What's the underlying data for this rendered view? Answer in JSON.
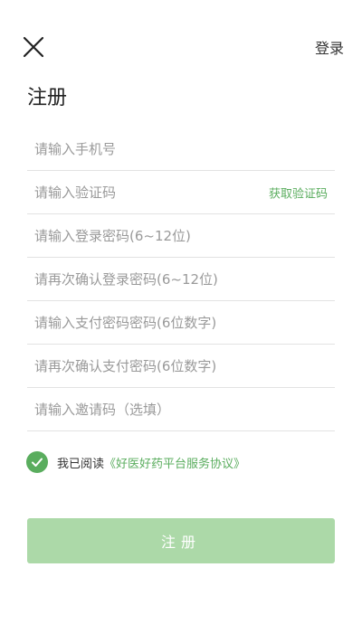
{
  "header": {
    "close_icon": "close-icon",
    "login_label": "登录"
  },
  "page": {
    "title": "注册"
  },
  "form": {
    "phone_placeholder": "请输入手机号",
    "code_placeholder": "请输入验证码",
    "get_code_label": "获取验证码",
    "password_placeholder": "请输入登录密码(6~12位)",
    "password_confirm_placeholder": "请再次确认登录密码(6~12位)",
    "pay_password_placeholder": "请输入支付密码密码(6位数字)",
    "pay_password_confirm_placeholder": "请再次确认支付密码(6位数字)",
    "invite_placeholder": "请输入邀请码（选填）"
  },
  "agreement": {
    "checked": true,
    "check_icon": "checkmark-icon",
    "prefix": "我已阅读",
    "link": "《好医好药平台服务协议》"
  },
  "submit": {
    "label": "注册"
  },
  "colors": {
    "accent": "#5aad5e",
    "button_disabled": "#acd9a8",
    "divider": "#e2e2e2",
    "placeholder": "#9a9a9a"
  }
}
